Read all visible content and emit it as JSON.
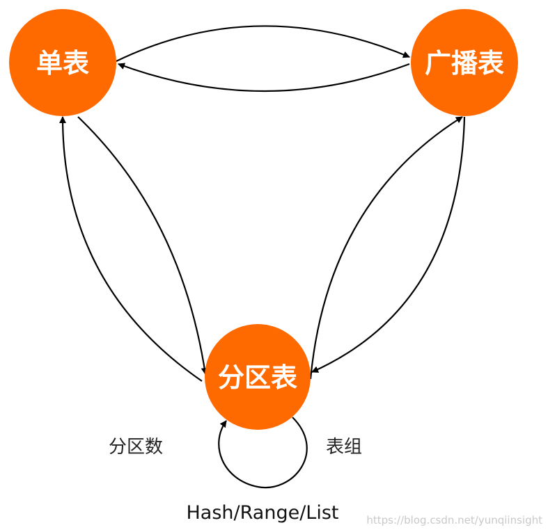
{
  "colors": {
    "node_fill": "#ff6a00",
    "node_text": "#ffffff",
    "edge": "#000000"
  },
  "nodes": {
    "single": {
      "label": "单表"
    },
    "broadcast": {
      "label": "广播表"
    },
    "partition": {
      "label": "分区表"
    }
  },
  "labels": {
    "left": "分区数",
    "right": "表组",
    "bottom": "Hash/Range/List"
  },
  "watermark": "https://blog.csdn.net/yunqiinsight"
}
